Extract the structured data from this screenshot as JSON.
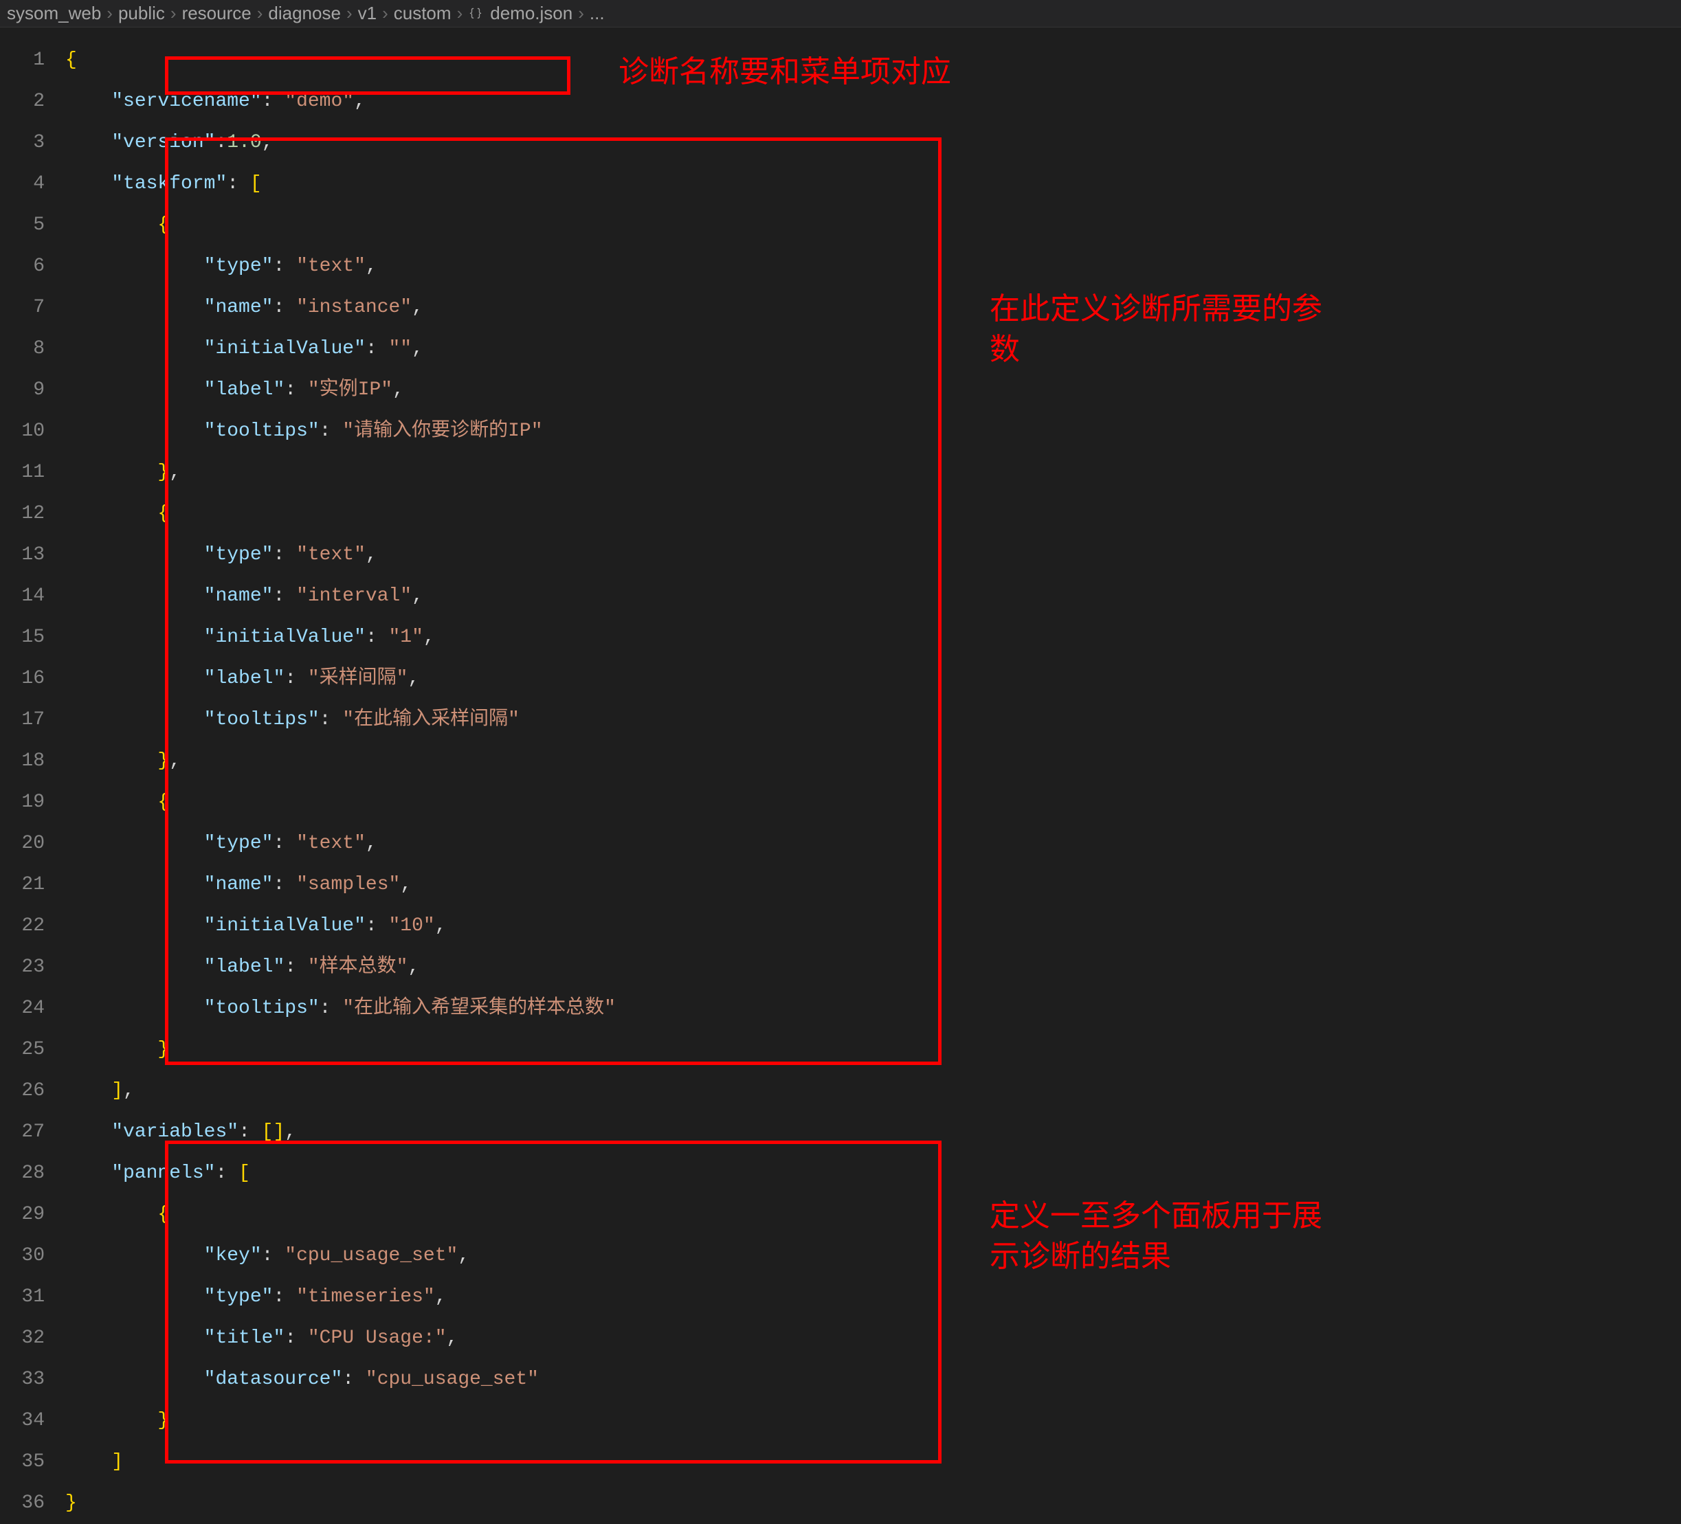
{
  "breadcrumbs": {
    "seg1": "sysom_web",
    "seg2": "public",
    "seg3": "resource",
    "seg4": "diagnose",
    "seg5": "v1",
    "seg6": "custom",
    "seg7": "demo.json",
    "seg8": "..."
  },
  "gutter": [
    "1",
    "2",
    "3",
    "4",
    "5",
    "6",
    "7",
    "8",
    "9",
    "10",
    "11",
    "12",
    "13",
    "14",
    "15",
    "16",
    "17",
    "18",
    "19",
    "20",
    "21",
    "22",
    "23",
    "24",
    "25",
    "26",
    "27",
    "28",
    "29",
    "30",
    "31",
    "32",
    "33",
    "34",
    "35",
    "36"
  ],
  "json": {
    "servicename": {
      "key": "\"servicename\"",
      "value": "\"demo\""
    },
    "version": {
      "key": "\"version\"",
      "value": "1.0"
    },
    "taskform_key": "\"taskform\"",
    "tf": [
      {
        "type_k": "\"type\"",
        "type_v": "\"text\"",
        "name_k": "\"name\"",
        "name_v": "\"instance\"",
        "init_k": "\"initialValue\"",
        "init_v": "\"\"",
        "label_k": "\"label\"",
        "label_v": "\"实例IP\"",
        "tip_k": "\"tooltips\"",
        "tip_v": "\"请输入你要诊断的IP\""
      },
      {
        "type_k": "\"type\"",
        "type_v": "\"text\"",
        "name_k": "\"name\"",
        "name_v": "\"interval\"",
        "init_k": "\"initialValue\"",
        "init_v": "\"1\"",
        "label_k": "\"label\"",
        "label_v": "\"采样间隔\"",
        "tip_k": "\"tooltips\"",
        "tip_v": "\"在此输入采样间隔\""
      },
      {
        "type_k": "\"type\"",
        "type_v": "\"text\"",
        "name_k": "\"name\"",
        "name_v": "\"samples\"",
        "init_k": "\"initialValue\"",
        "init_v": "\"10\"",
        "label_k": "\"label\"",
        "label_v": "\"样本总数\"",
        "tip_k": "\"tooltips\"",
        "tip_v": "\"在此输入希望采集的样本总数\""
      }
    ],
    "variables_key": "\"variables\"",
    "pannels_key": "\"pannels\"",
    "pn": {
      "key_k": "\"key\"",
      "key_v": "\"cpu_usage_set\"",
      "type_k": "\"type\"",
      "type_v": "\"timeseries\"",
      "title_k": "\"title\"",
      "title_v": "\"CPU Usage:\"",
      "ds_k": "\"datasource\"",
      "ds_v": "\"cpu_usage_set\""
    }
  },
  "annot": {
    "a1": "诊断名称要和菜单项对应",
    "a2": "在此定义诊断所需要的参数",
    "a3": "定义一至多个面板用于展示诊断的结果"
  }
}
